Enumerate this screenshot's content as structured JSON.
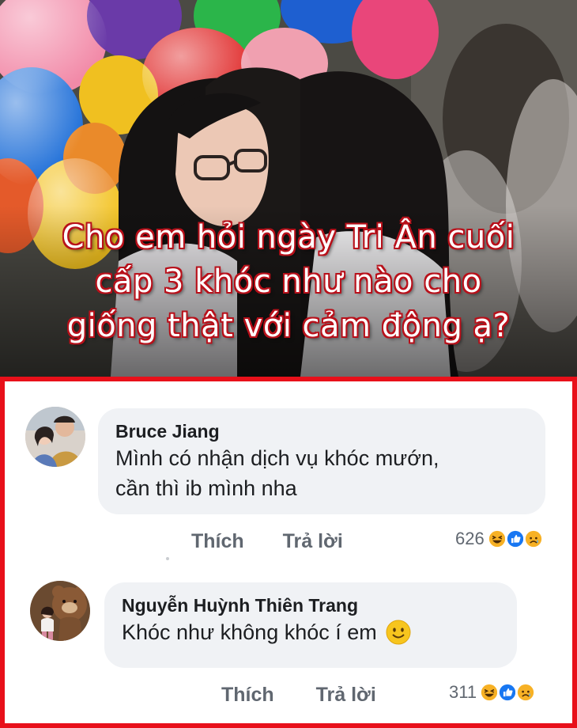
{
  "banner": {
    "caption_lines": [
      "Cho em hỏi ngày Tri Ân cuối",
      "cấp 3 khóc như nào cho",
      "giống thật với cảm động ạ?"
    ]
  },
  "comments": [
    {
      "author": "Bruce Jiang",
      "text_lines": [
        "Mình có nhận dịch vụ khóc mướn,",
        "cần thì ib mình nha"
      ],
      "like_label": "Thích",
      "reply_label": "Trả lời",
      "reaction_count": "626",
      "reactions": [
        "haha-icon",
        "like-icon",
        "sad-icon"
      ]
    },
    {
      "author": "Nguyễn Huỳnh Thiên Trang",
      "text_lines": [
        "Khóc như không khóc í em"
      ],
      "emoji": "smile-emoji",
      "like_label": "Thích",
      "reply_label": "Trả lời",
      "reaction_count": "311",
      "reactions": [
        "haha-icon",
        "like-icon",
        "sad-icon"
      ]
    }
  ],
  "colors": {
    "frame": "#e8101a",
    "caption_outline": "#b8101a",
    "bubble": "#f0f2f5",
    "like_blue": "#1877f2",
    "haha_yellow": "#f7b125"
  }
}
